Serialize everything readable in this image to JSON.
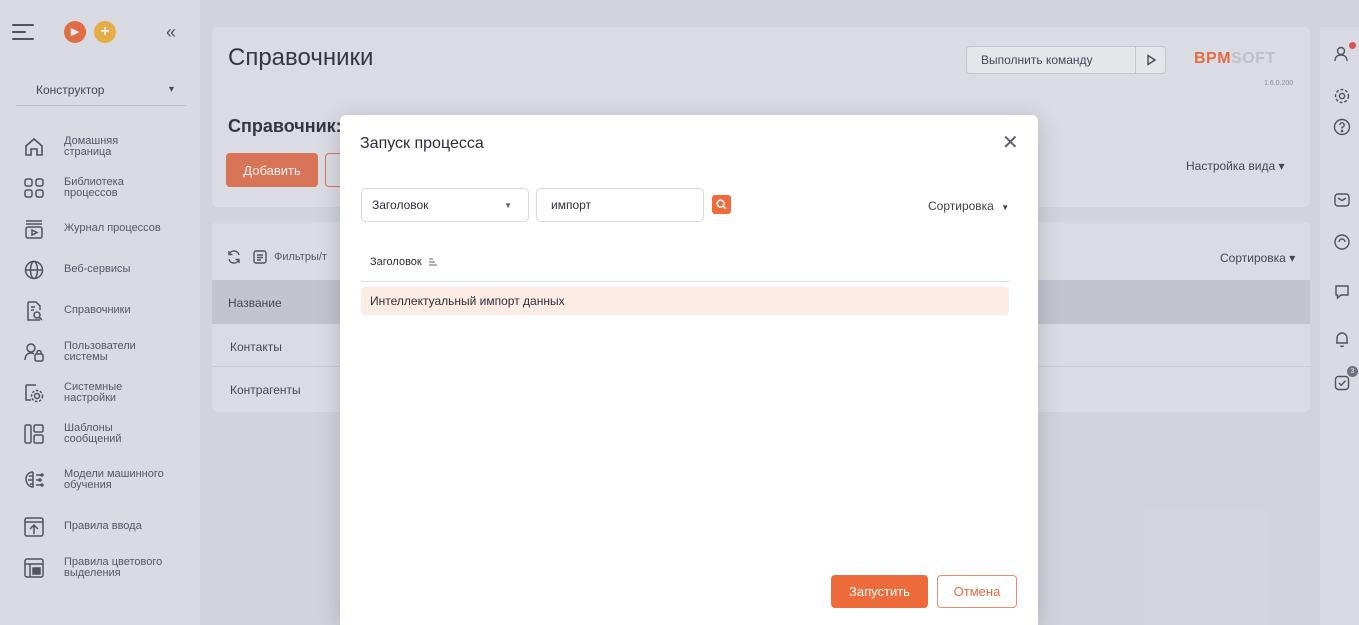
{
  "sidebar": {
    "role": "Конструктор",
    "items": [
      {
        "label": "Домашняя страница",
        "icon": "home-icon"
      },
      {
        "label": "Библиотека процессов",
        "icon": "process-library-icon"
      },
      {
        "label": "Журнал процессов",
        "icon": "process-log-icon"
      },
      {
        "label": "Веб-сервисы",
        "icon": "globe-icon"
      },
      {
        "label": "Справочники",
        "icon": "lookup-icon"
      },
      {
        "label": "Пользователи системы",
        "icon": "users-icon"
      },
      {
        "label": "Системные настройки",
        "icon": "settings-icon"
      },
      {
        "label": "Шаблоны сообщений",
        "icon": "templates-icon"
      },
      {
        "label": "Модели машинного обучения",
        "icon": "ml-icon"
      },
      {
        "label": "Правила ввода",
        "icon": "input-rules-icon"
      },
      {
        "label": "Правила цветового выделения",
        "icon": "color-rules-icon"
      }
    ]
  },
  "header": {
    "title": "Справочники",
    "command_placeholder": "Выполнить команду",
    "logo_bpm": "BPM",
    "logo_soft": "SOFT",
    "version": "1.6.0.200"
  },
  "section": {
    "subtitle": "Справочник: [Ш",
    "add_button": "Добавить",
    "view_settings": "Настройка вида ▾",
    "filters_label": "Фильтры/т",
    "sort_label": "Сортировка ▾",
    "column_header": "Название",
    "rows": [
      "Контакты",
      "Контрагенты"
    ]
  },
  "right_rail": {
    "tasks_badge": "3"
  },
  "modal": {
    "title": "Запуск процесса",
    "filter_field": "Заголовок",
    "search_value": "импорт",
    "sort_label": "Сортировка",
    "column_header": "Заголовок",
    "rows": [
      "Интеллектуальный импорт данных"
    ],
    "run_button": "Запустить",
    "cancel_button": "Отмена"
  },
  "colors": {
    "accent": "#ee6b3b",
    "selected_row": "#fcece5",
    "background": "#dfe1e8"
  }
}
